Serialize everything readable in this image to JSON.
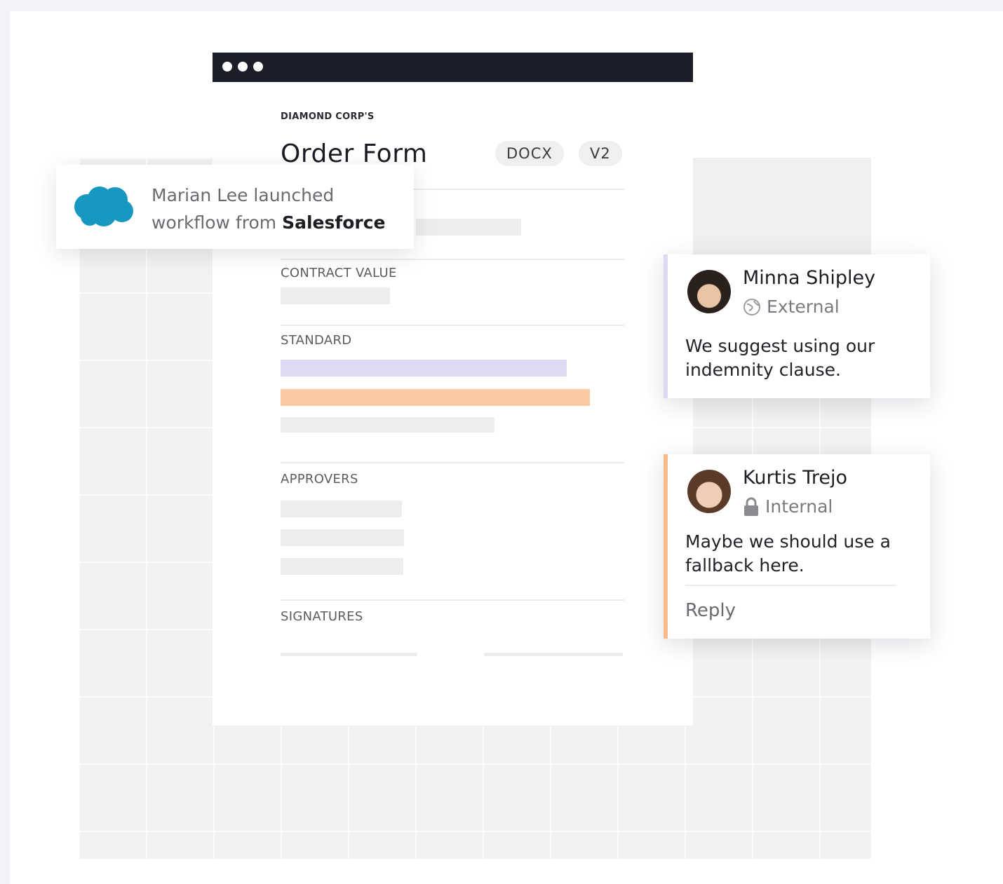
{
  "document": {
    "eyebrow": "DIAMOND CORP'S",
    "title": "Order Form",
    "format_badge": "DOCX",
    "version_badge": "V2",
    "sections": {
      "contract_value": "CONTRACT VALUE",
      "standard": "STANDARD",
      "approvers": "APPROVERS",
      "signatures": "SIGNATURES"
    }
  },
  "notification": {
    "icon": "salesforce-cloud-icon",
    "text_prefix": "Marian Lee launched",
    "text_line2": "workflow from ",
    "source": "Salesforce"
  },
  "comments": [
    {
      "author": "Minna Shipley",
      "visibility": "External",
      "visibility_icon": "globe-icon",
      "text": "We suggest using our indemnity clause.",
      "accent": "#dcdaf0"
    },
    {
      "author": "Kurtis Trejo",
      "visibility": "Internal",
      "visibility_icon": "lock-icon",
      "text": "Maybe we should use a fallback here.",
      "accent": "#f8b98c",
      "reply_label": "Reply"
    }
  ],
  "colors": {
    "titlebar": "#1b1d29",
    "highlight_lavender": "#dcdaf0",
    "highlight_peach": "#fbcaa5",
    "salesforce_blue": "#1798c1"
  }
}
